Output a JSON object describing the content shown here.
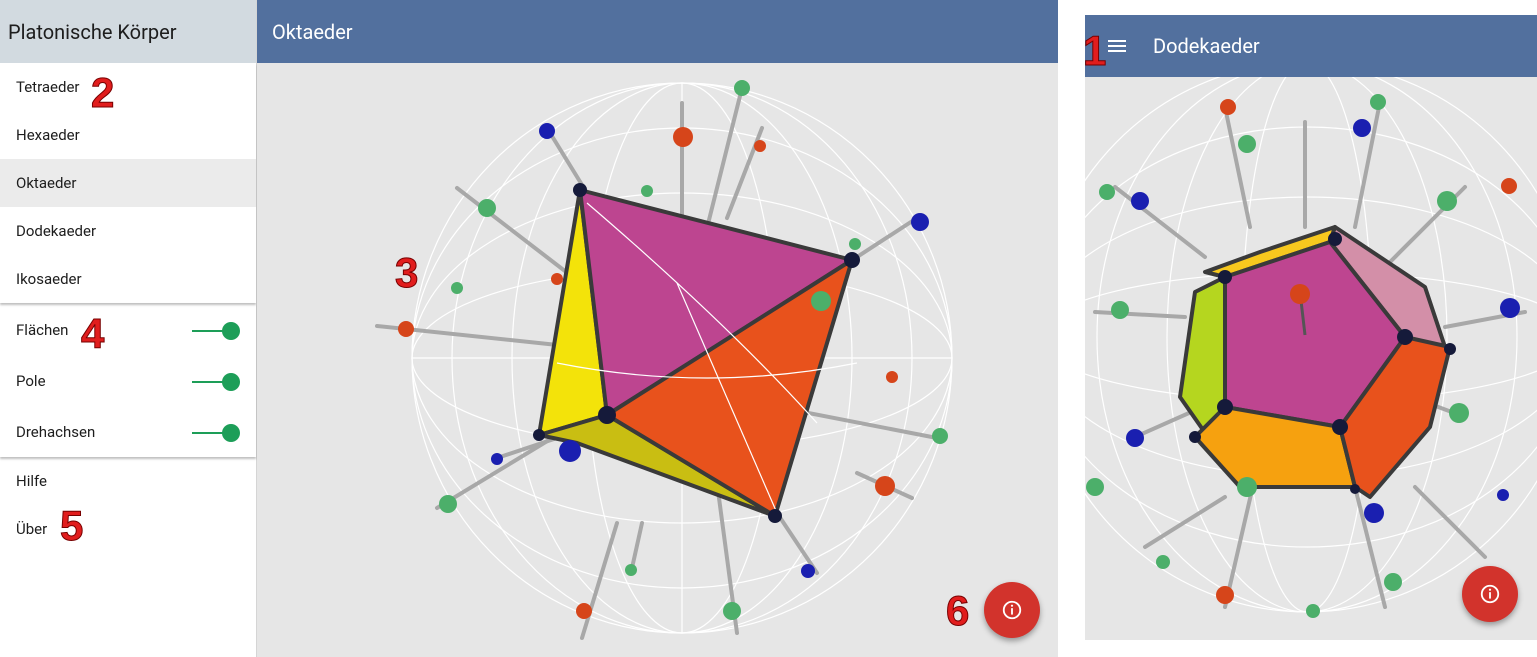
{
  "drawer": {
    "title": "Platonische Körper",
    "solids": [
      {
        "label": "Tetraeder"
      },
      {
        "label": "Hexaeder"
      },
      {
        "label": "Oktaeder"
      },
      {
        "label": "Dodekaeder"
      },
      {
        "label": "Ikosaeder"
      }
    ],
    "active_solid": "Oktaeder",
    "toggles": [
      {
        "label": "Flächen",
        "on": true
      },
      {
        "label": "Pole",
        "on": true
      },
      {
        "label": "Drehachsen",
        "on": true
      }
    ],
    "links": [
      {
        "label": "Hilfe"
      },
      {
        "label": "Über"
      }
    ]
  },
  "main_view": {
    "title": "Oktaeder",
    "fab_icon": "info-icon"
  },
  "side_view": {
    "title": "Dodekaeder",
    "menu_icon": "hamburger-menu-icon",
    "fab_icon": "info-icon"
  },
  "callouts": [
    "1",
    "2",
    "3",
    "4",
    "5",
    "6"
  ],
  "colors": {
    "appbar": "#52709e",
    "drawer_header": "#d2dae0",
    "toggle_on": "#1d9e58",
    "fab": "#d2332c",
    "callout": "#e11d1d"
  }
}
